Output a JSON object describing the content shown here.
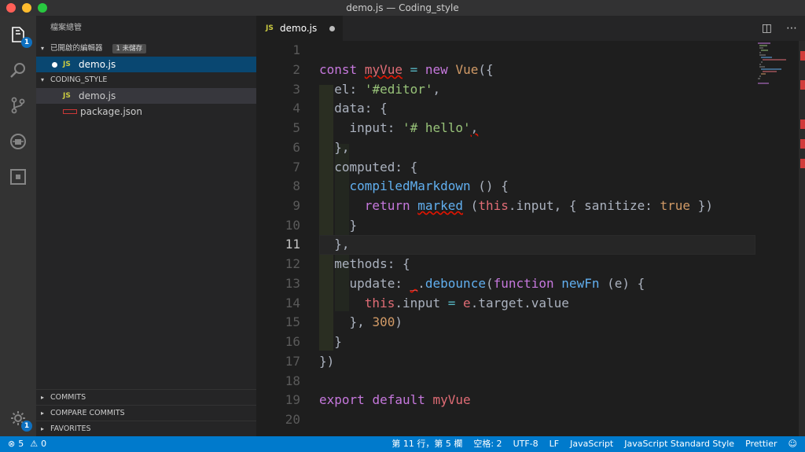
{
  "window": {
    "title": "demo.js — Coding_style"
  },
  "activity": {
    "explorer_badge": "1",
    "settings_badge": "1"
  },
  "sidebar": {
    "title": "檔案總管",
    "open_editors": {
      "label": "已開啟的編輯器",
      "badge": "1 未儲存",
      "items": [
        {
          "icon": "JS",
          "name": "demo.js"
        }
      ]
    },
    "project": {
      "label": "CODING_STYLE",
      "items": [
        {
          "icon": "JS",
          "name": "demo.js"
        },
        {
          "icon": "npm",
          "name": "package.json"
        }
      ]
    },
    "sections": [
      "COMMITS",
      "COMPARE COMMITS",
      "FAVORITES"
    ]
  },
  "tab": {
    "icon": "JS",
    "name": "demo.js"
  },
  "editor": {
    "line_numbers": [
      "1",
      "2",
      "3",
      "4",
      "5",
      "6",
      "7",
      "8",
      "9",
      "10",
      "11",
      "12",
      "13",
      "14",
      "15",
      "16",
      "17",
      "18",
      "19",
      "20"
    ]
  },
  "status": {
    "errors": "5",
    "warnings": "0",
    "position": "第 11 行，第 5 欄",
    "indent": "空格: 2",
    "encoding": "UTF-8",
    "eol": "LF",
    "language": "JavaScript",
    "linter": "JavaScript Standard Style",
    "formatter": "Prettier"
  }
}
